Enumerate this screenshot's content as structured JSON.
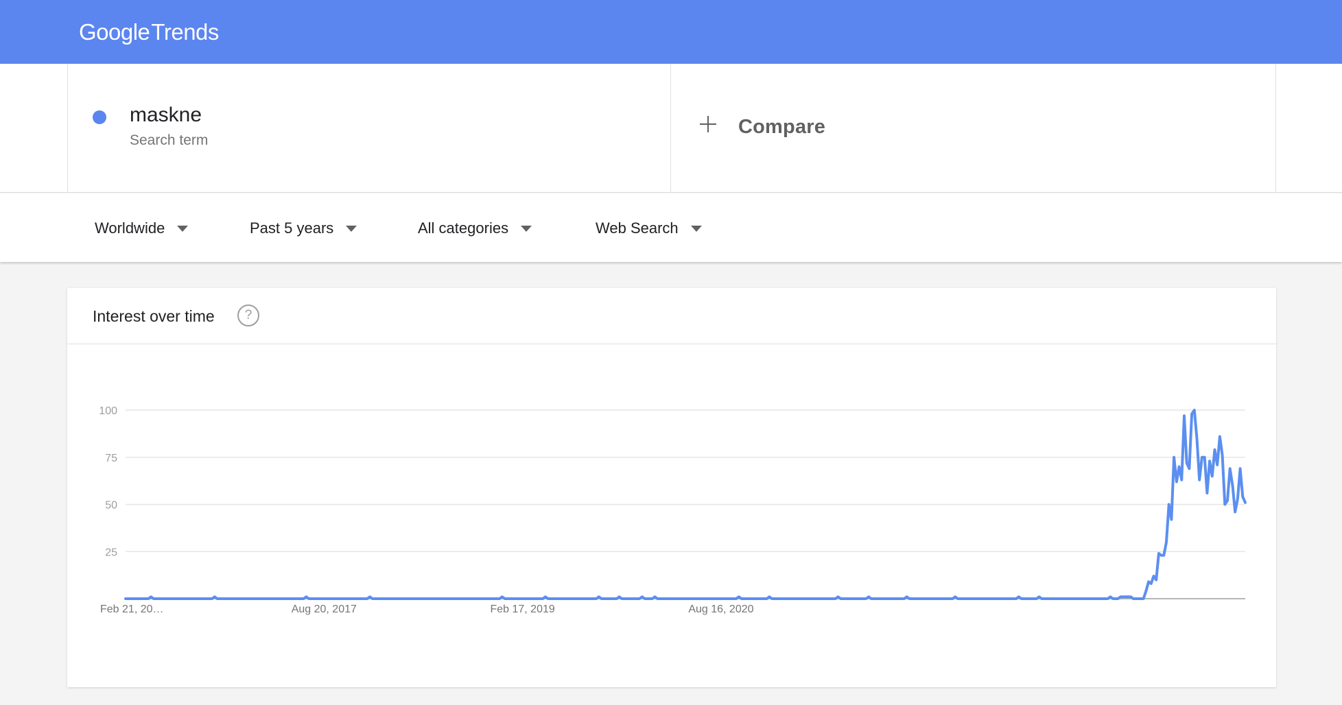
{
  "header": {
    "logo_google": "Google",
    "logo_trends": "Trends"
  },
  "search_terms": [
    {
      "name": "maskne",
      "subtitle": "Search term",
      "color": "#5b85ef"
    }
  ],
  "compare": {
    "label": "Compare"
  },
  "filters": {
    "region": "Worldwide",
    "time_range": "Past 5 years",
    "category": "All categories",
    "search_type": "Web Search"
  },
  "interest_card": {
    "title": "Interest over time",
    "help_icon": "help-circle-icon"
  },
  "colors": {
    "header": "#5b85ef",
    "series": "#5b8ff0"
  },
  "chart_data": {
    "type": "line",
    "title": "Interest over time",
    "ylim": [
      0,
      100
    ],
    "y_ticks": [
      "25",
      "50",
      "75",
      "100"
    ],
    "y_tick_values": [
      25,
      50,
      75,
      100
    ],
    "x_tick_labels": [
      "Feb 21, 20…",
      "Aug 20, 2017",
      "Feb 17, 2019",
      "Aug 16, 2020"
    ],
    "x_tick_index": [
      0,
      78,
      156,
      234
    ],
    "grid": true,
    "series": [
      {
        "name": "maskne",
        "values": [
          0,
          0,
          0,
          0,
          0,
          0,
          0,
          0,
          0,
          0,
          1,
          0,
          0,
          0,
          0,
          0,
          0,
          0,
          0,
          0,
          0,
          0,
          0,
          0,
          0,
          0,
          0,
          0,
          0,
          0,
          0,
          0,
          0,
          0,
          0,
          1,
          0,
          0,
          0,
          0,
          0,
          0,
          0,
          0,
          0,
          0,
          0,
          0,
          0,
          0,
          0,
          0,
          0,
          0,
          0,
          0,
          0,
          0,
          0,
          0,
          0,
          0,
          0,
          0,
          0,
          0,
          0,
          0,
          0,
          0,
          0,
          1,
          0,
          0,
          0,
          0,
          0,
          0,
          0,
          0,
          0,
          0,
          0,
          0,
          0,
          0,
          0,
          0,
          0,
          0,
          0,
          0,
          0,
          0,
          0,
          0,
          1,
          0,
          0,
          0,
          0,
          0,
          0,
          0,
          0,
          0,
          0,
          0,
          0,
          0,
          0,
          0,
          0,
          0,
          0,
          0,
          0,
          0,
          0,
          0,
          0,
          0,
          0,
          0,
          0,
          0,
          0,
          0,
          0,
          0,
          0,
          0,
          0,
          0,
          0,
          0,
          0,
          0,
          0,
          0,
          0,
          0,
          0,
          0,
          0,
          0,
          0,
          0,
          1,
          0,
          0,
          0,
          0,
          0,
          0,
          0,
          0,
          0,
          0,
          0,
          0,
          0,
          0,
          0,
          0,
          1,
          0,
          0,
          0,
          0,
          0,
          0,
          0,
          0,
          0,
          0,
          0,
          0,
          0,
          0,
          0,
          0,
          0,
          0,
          0,
          0,
          1,
          0,
          0,
          0,
          0,
          0,
          0,
          0,
          1,
          0,
          0,
          0,
          0,
          0,
          0,
          0,
          0,
          1,
          0,
          0,
          0,
          0,
          1,
          0,
          0,
          0,
          0,
          0,
          0,
          0,
          0,
          0,
          0,
          0,
          0,
          0,
          0,
          0,
          0,
          0,
          0,
          0,
          0,
          0,
          0,
          0,
          0,
          0,
          0,
          0,
          0,
          0,
          0,
          0,
          0,
          1,
          0,
          0,
          0,
          0,
          0,
          0,
          0,
          0,
          0,
          0,
          0,
          1,
          0,
          0,
          0,
          0,
          0,
          0,
          0,
          0,
          0,
          0,
          0,
          0,
          0,
          0,
          0,
          0,
          0,
          0,
          0,
          0,
          0,
          0,
          0,
          0,
          0,
          0,
          1,
          0,
          0,
          0,
          0,
          0,
          0,
          0,
          0,
          0,
          0,
          0,
          1,
          0,
          0,
          0,
          0,
          0,
          0,
          0,
          0,
          0,
          0,
          0,
          0,
          0,
          0,
          1,
          0,
          0,
          0,
          0,
          0,
          0,
          0,
          0,
          0,
          0,
          0,
          0,
          0,
          0,
          0,
          0,
          0,
          0,
          1,
          0,
          0,
          0,
          0,
          0,
          0,
          0,
          0,
          0,
          0,
          0,
          0,
          0,
          0,
          0,
          0,
          0,
          0,
          0,
          0,
          0,
          0,
          0,
          0,
          1,
          0,
          0,
          0,
          0,
          0,
          0,
          0,
          1,
          0,
          0,
          0,
          0,
          0,
          0,
          0,
          0,
          0,
          0,
          0,
          0,
          0,
          0,
          0,
          0,
          0,
          0,
          0,
          0,
          0,
          0,
          0,
          0,
          0,
          0,
          0,
          1,
          0,
          0,
          0,
          1,
          1,
          1,
          1,
          1,
          0,
          0,
          0,
          0,
          0,
          4,
          9,
          8,
          12,
          10,
          24,
          23,
          23,
          30,
          50,
          42,
          75,
          62,
          70,
          63,
          97,
          72,
          69,
          98,
          100,
          85,
          63,
          75,
          75,
          56,
          73,
          65,
          79,
          71,
          86,
          76,
          50,
          52,
          69,
          60,
          46,
          53,
          69,
          54,
          51
        ]
      }
    ]
  }
}
